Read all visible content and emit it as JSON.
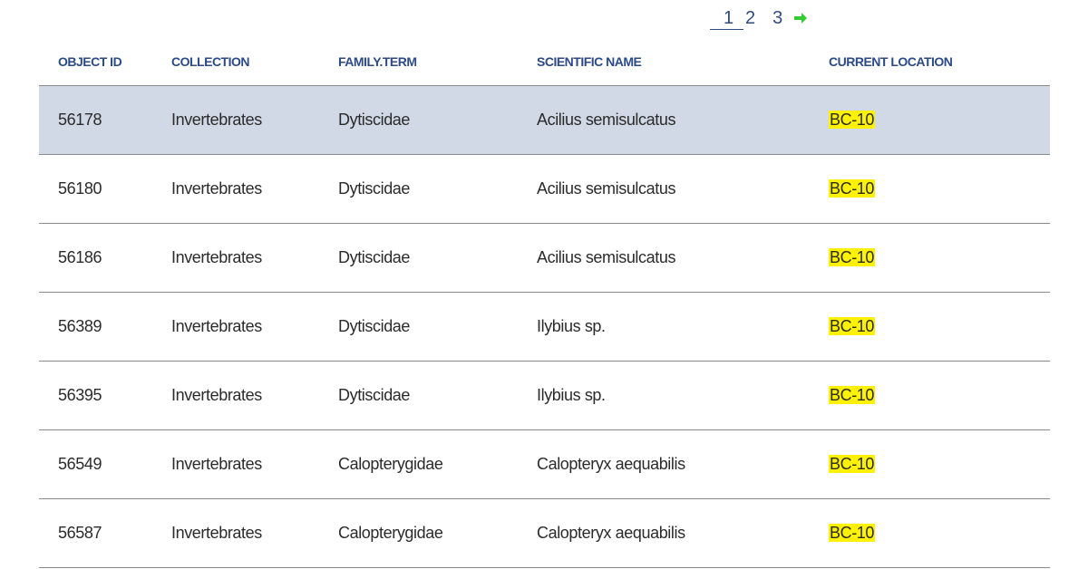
{
  "pagination": {
    "pages": [
      "1",
      "2",
      "3"
    ],
    "current": "1",
    "next_icon": "arrow-right-icon",
    "next_color": "#33cc33"
  },
  "table": {
    "headers": {
      "object_id": "OBJECT ID",
      "collection": "COLLECTION",
      "family_term": "FAMILY.TERM",
      "scientific_name": "SCIENTIFIC NAME",
      "current_location": "CURRENT LOCATION"
    },
    "rows": [
      {
        "object_id": "56178",
        "collection": "Invertebrates",
        "family_term": "Dytiscidae",
        "scientific_name": "Acilius semisulcatus",
        "current_location": "BC-10",
        "selected": true
      },
      {
        "object_id": "56180",
        "collection": "Invertebrates",
        "family_term": "Dytiscidae",
        "scientific_name": "Acilius semisulcatus",
        "current_location": "BC-10",
        "selected": false
      },
      {
        "object_id": "56186",
        "collection": "Invertebrates",
        "family_term": "Dytiscidae",
        "scientific_name": "Acilius semisulcatus",
        "current_location": "BC-10",
        "selected": false
      },
      {
        "object_id": "56389",
        "collection": "Invertebrates",
        "family_term": "Dytiscidae",
        "scientific_name": "Ilybius sp.",
        "current_location": "BC-10",
        "selected": false
      },
      {
        "object_id": "56395",
        "collection": "Invertebrates",
        "family_term": "Dytiscidae",
        "scientific_name": "Ilybius sp.",
        "current_location": "BC-10",
        "selected": false
      },
      {
        "object_id": "56549",
        "collection": "Invertebrates",
        "family_term": "Calopterygidae",
        "scientific_name": "Calopteryx aequabilis",
        "current_location": "BC-10",
        "selected": false
      },
      {
        "object_id": "56587",
        "collection": "Invertebrates",
        "family_term": "Calopterygidae",
        "scientific_name": "Calopteryx aequabilis",
        "current_location": "BC-10",
        "selected": false
      }
    ]
  },
  "colors": {
    "header_text": "#2c4a86",
    "selected_row": "#d1d9e6",
    "location_highlight": "#fff200",
    "row_divider": "#8a8a8a"
  }
}
